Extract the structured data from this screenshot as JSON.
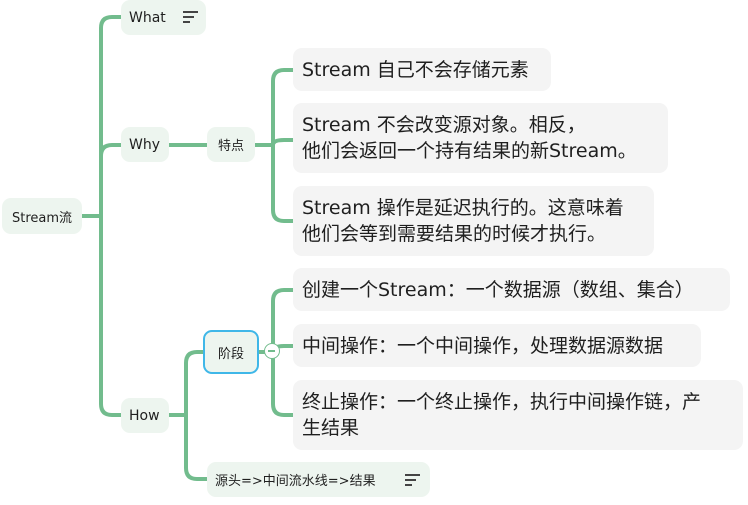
{
  "map": {
    "root": {
      "label": "Stream流"
    },
    "what": {
      "label": "What",
      "note_icon": "note-lines-icon"
    },
    "why": {
      "label": "Why",
      "child": {
        "label": "特点",
        "items": [
          {
            "lines": [
              "Stream 自己不会存储元素"
            ]
          },
          {
            "lines": [
              "Stream 不会改变源对象。相反，",
              "他们会返回一个持有结果的新Stream。"
            ]
          },
          {
            "lines": [
              "Stream 操作是延迟执行的。这意味着",
              "他们会等到需要结果的时候才执行。"
            ]
          }
        ]
      }
    },
    "how": {
      "label": "How",
      "stages": {
        "label": "阶段",
        "items": [
          {
            "lines": [
              "创建一个Stream：一个数据源（数组、集合）"
            ]
          },
          {
            "lines": [
              "中间操作：一个中间操作，处理数据源数据"
            ]
          },
          {
            "lines": [
              "终止操作：一个终止操作，执行中间操作链，产",
              "生结果"
            ]
          }
        ]
      },
      "pipeline": {
        "label": "源头=>中间流水线=>结果",
        "note_icon": "note-lines-icon"
      }
    },
    "colors": {
      "branch": "#72bc8d",
      "node_fill": "#edf5ef",
      "leaf_fill": "#f4f4f4",
      "selection": "#3fb7e8"
    }
  }
}
